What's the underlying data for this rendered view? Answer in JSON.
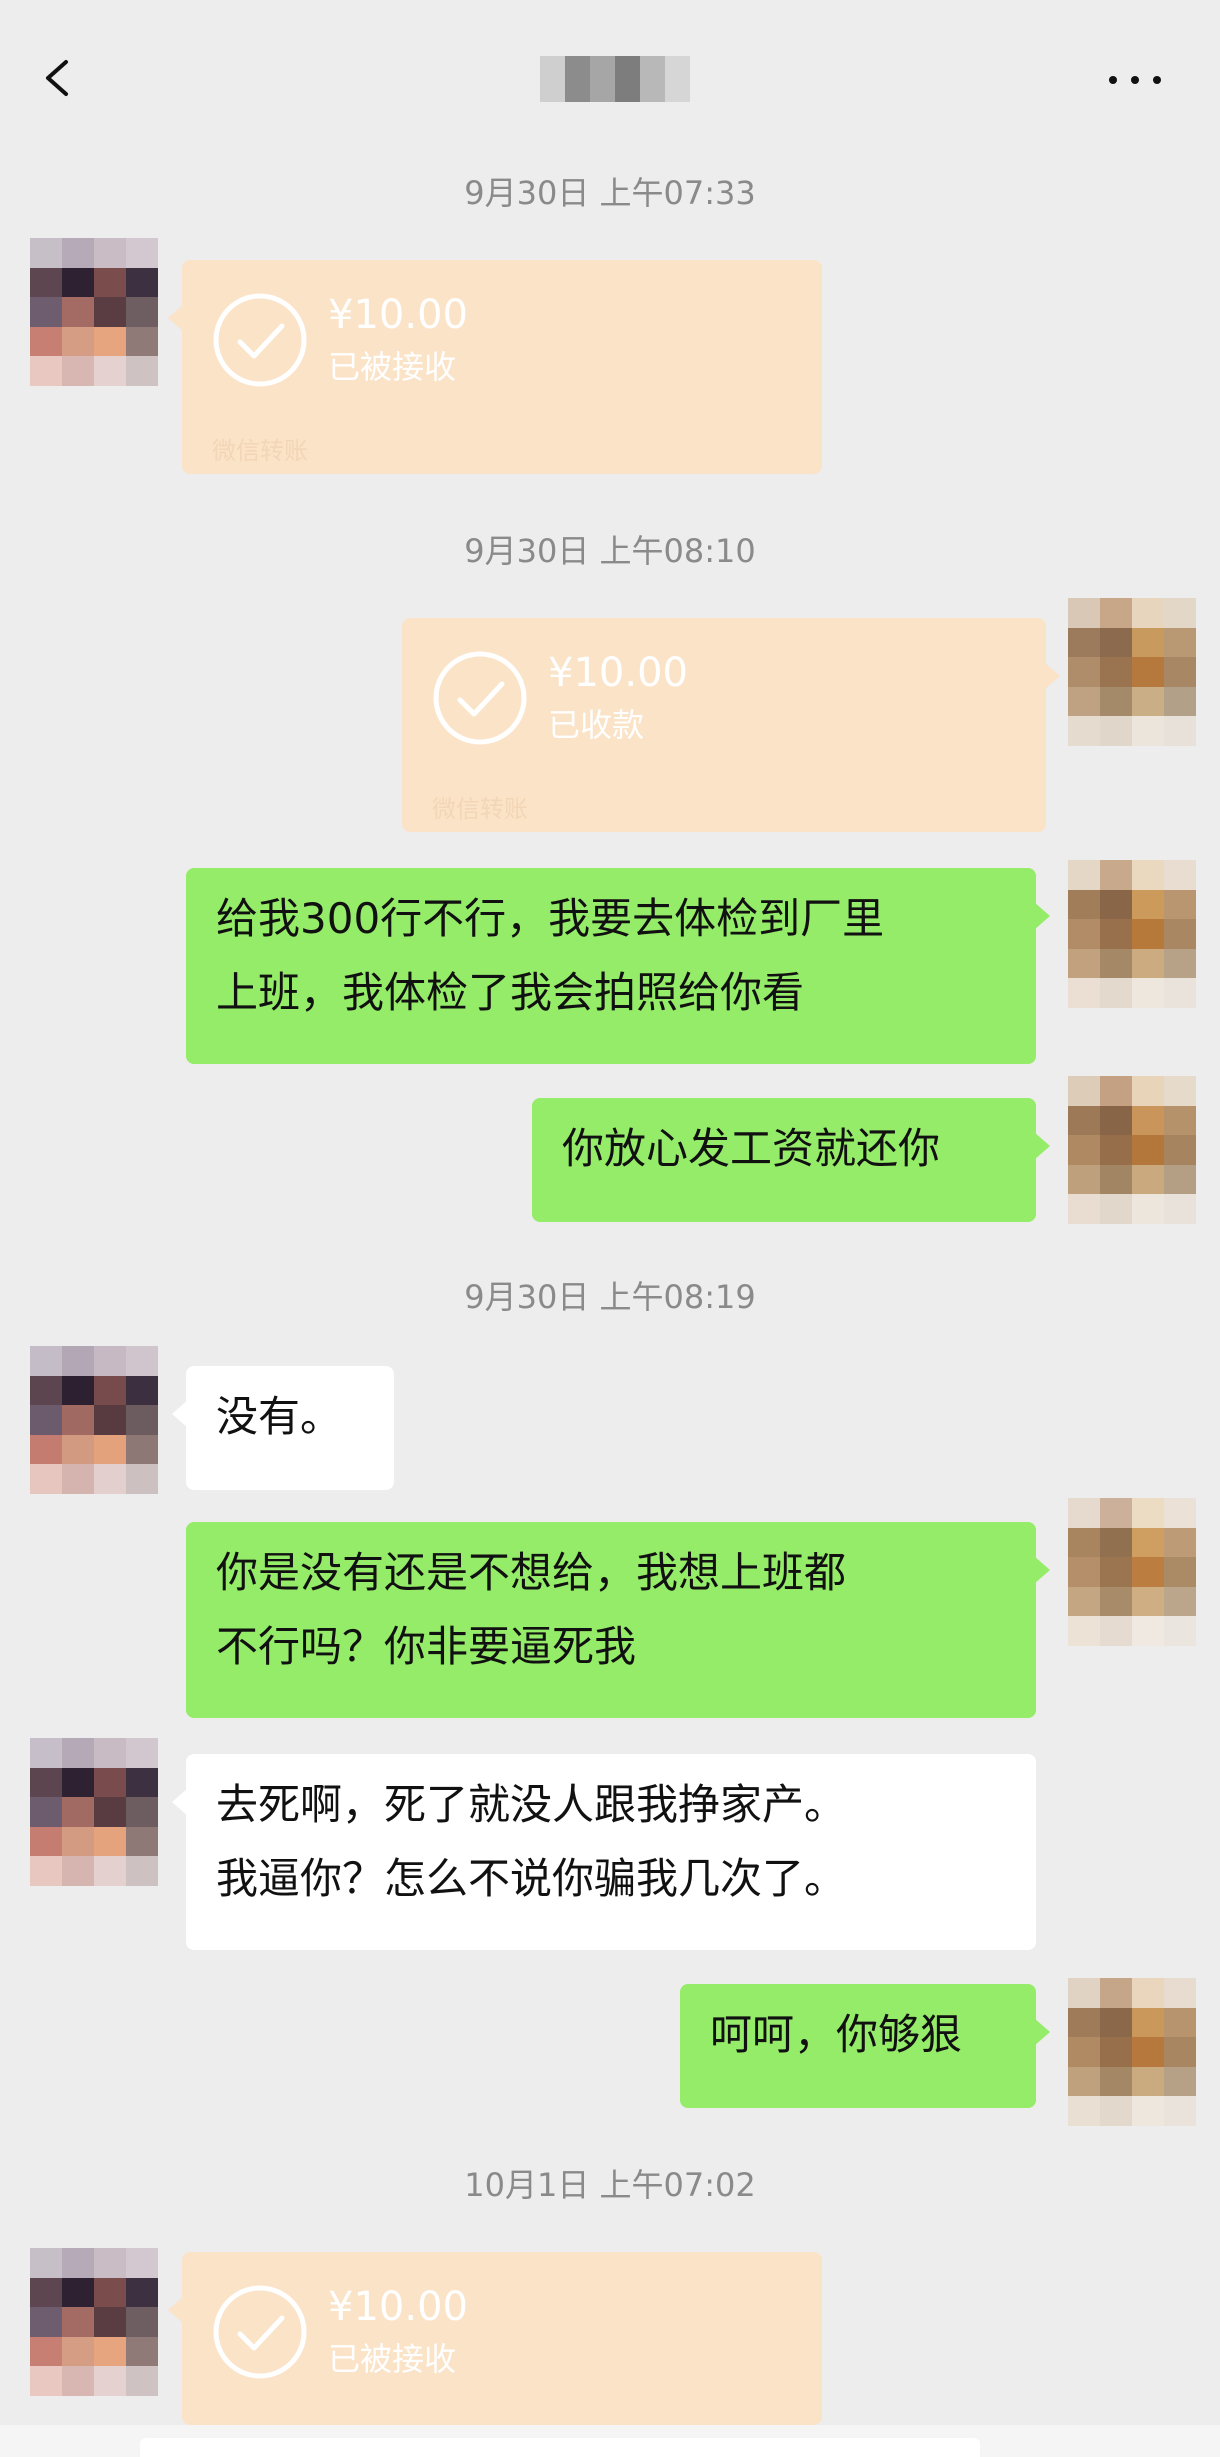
{
  "header": {
    "back_icon": "chevron-left-icon",
    "title": "",
    "more_icon": "more-horizontal-icon"
  },
  "messages": [
    {
      "type": "timestamp",
      "text": "9月30日 上午07:33"
    },
    {
      "type": "transfer",
      "side": "left",
      "amount": "¥10.00",
      "status": "已被接收",
      "footer": "微信转账",
      "icon": "check-circle-icon"
    },
    {
      "type": "timestamp",
      "text": "9月30日 上午08:10"
    },
    {
      "type": "transfer",
      "side": "right",
      "amount": "¥10.00",
      "status": "已收款",
      "footer": "微信转账",
      "icon": "check-circle-icon"
    },
    {
      "type": "text",
      "side": "right",
      "lines": [
        "给我300行不行，我要去体检到厂里",
        "上班，我体检了我会拍照给你看"
      ]
    },
    {
      "type": "text",
      "side": "right",
      "lines": [
        "你放心发工资就还你"
      ]
    },
    {
      "type": "timestamp",
      "text": "9月30日 上午08:19"
    },
    {
      "type": "text",
      "side": "left",
      "lines": [
        "没有。"
      ]
    },
    {
      "type": "text",
      "side": "right",
      "lines": [
        "你是没有还是不想给，我想上班都",
        "不行吗？你非要逼死我"
      ]
    },
    {
      "type": "text",
      "side": "left",
      "lines": [
        "去死啊，死了就没人跟我挣家产。",
        "我逼你？怎么不说你骗我几次了。"
      ]
    },
    {
      "type": "text",
      "side": "right",
      "lines": [
        "呵呵，你够狠"
      ]
    },
    {
      "type": "timestamp",
      "text": "10月1日 上午07:02"
    },
    {
      "type": "transfer",
      "side": "left",
      "amount": "¥10.00",
      "status": "已被接收",
      "footer": "",
      "icon": "check-circle-icon"
    }
  ],
  "colors": {
    "background": "#ededed",
    "bubble_green": "#95ec69",
    "bubble_white": "#ffffff",
    "transfer_card": "#fbe3c8",
    "timestamp_text": "#8a8a8a"
  }
}
